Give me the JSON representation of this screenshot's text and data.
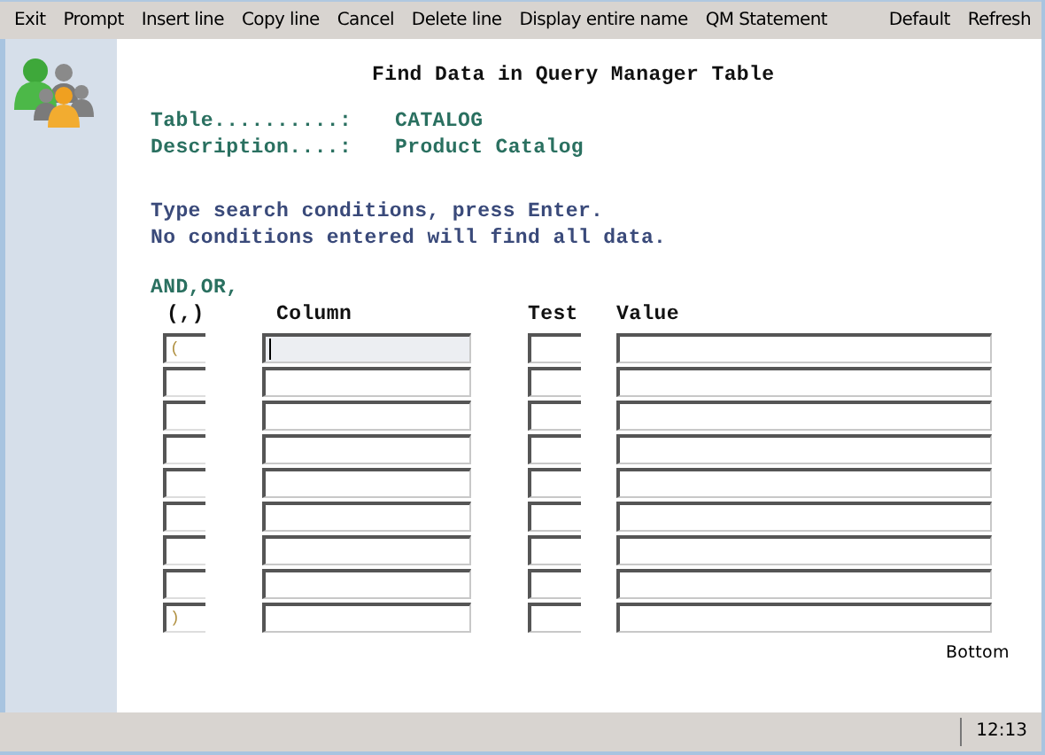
{
  "menu": [
    "Exit",
    "Prompt",
    "Insert line",
    "Copy line",
    "Cancel",
    "Delete line",
    "Display entire name",
    "QM Statement"
  ],
  "menu_right": [
    "Default",
    "Refresh"
  ],
  "title": "Find Data in Query Manager Table",
  "info": [
    {
      "label": "Table..........:",
      "value": "CATALOG"
    },
    {
      "label": "Description....:",
      "value": "Product Catalog"
    }
  ],
  "instructions": [
    "Type search conditions, press Enter.",
    "No conditions entered will find all data."
  ],
  "andor_label": "AND,OR,",
  "columns": [
    "(,)",
    "Column",
    "Test",
    "Value"
  ],
  "rows": [
    {
      "paren": "(",
      "focused": true
    },
    {
      "focused": false
    },
    {
      "focused": false
    },
    {
      "focused": false
    },
    {
      "focused": false
    },
    {
      "focused": false
    },
    {
      "focused": false
    },
    {
      "focused": false
    },
    {
      "paren": ")",
      "focused": false
    }
  ],
  "position": "Bottom",
  "status_bar": {
    "time": "12:13"
  }
}
